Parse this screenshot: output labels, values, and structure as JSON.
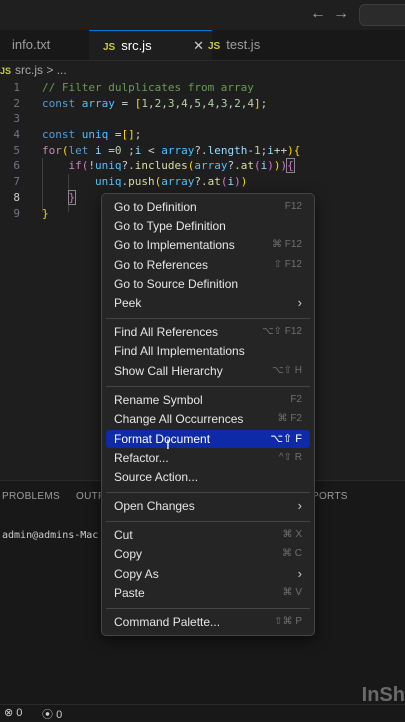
{
  "topbar": {
    "back_icon": "←",
    "forward_icon": "→"
  },
  "tabs": [
    {
      "label": "info.txt"
    },
    {
      "prefix": "JS",
      "label": "src.js",
      "close": "✕"
    },
    {
      "prefix": "JS",
      "label": "test.js"
    }
  ],
  "breadcrumb": {
    "prefix": "JS",
    "file": "src.js",
    "sep": ">",
    "more": "..."
  },
  "editor": {
    "line_numbers": [
      "1",
      "2",
      "3",
      "4",
      "5",
      "6",
      "7",
      "8",
      "9"
    ]
  },
  "context_menu": {
    "items": [
      {
        "label": "Go to Definition",
        "shortcut": "F12"
      },
      {
        "label": "Go to Type Definition",
        "shortcut": ""
      },
      {
        "label": "Go to Implementations",
        "shortcut": "⌘ F12"
      },
      {
        "label": "Go to References",
        "shortcut": "⇧ F12"
      },
      {
        "label": "Go to Source Definition",
        "shortcut": ""
      },
      {
        "label": "Peek",
        "shortcut": ""
      },
      {
        "label": "Find All References",
        "shortcut": "⌥⇧ F12"
      },
      {
        "label": "Find All Implementations",
        "shortcut": ""
      },
      {
        "label": "Show Call Hierarchy",
        "shortcut": "⌥⇧ H"
      },
      {
        "label": "Rename Symbol",
        "shortcut": "F2"
      },
      {
        "label": "Change All Occurrences",
        "shortcut": "⌘ F2"
      },
      {
        "label": "Format Document",
        "shortcut": "⌥⇧ F"
      },
      {
        "label": "Refactor...",
        "shortcut": "^⇧ R"
      },
      {
        "label": "Source Action...",
        "shortcut": ""
      },
      {
        "label": "Open Changes",
        "shortcut": ""
      },
      {
        "label": "Cut",
        "shortcut": "⌘ X"
      },
      {
        "label": "Copy",
        "shortcut": "⌘ C"
      },
      {
        "label": "Copy As",
        "shortcut": ""
      },
      {
        "label": "Paste",
        "shortcut": "⌘ V"
      },
      {
        "label": "Command Palette...",
        "shortcut": "⇧⌘ P"
      }
    ],
    "submenu_arrow": "›"
  },
  "panel": {
    "tabs": [
      "PROBLEMS",
      "OUTP",
      "PORTS"
    ],
    "terminal_text": "admin@admins-Mac"
  },
  "statusbar": {
    "errors": "⊗ 0",
    "warnings": "⚠ 0",
    "ports": "0"
  },
  "watermark": "InSh",
  "colors": {
    "accent": "#0078d4",
    "menu_highlight": "#0e2aa8",
    "js_icon": "#cbcb41"
  }
}
